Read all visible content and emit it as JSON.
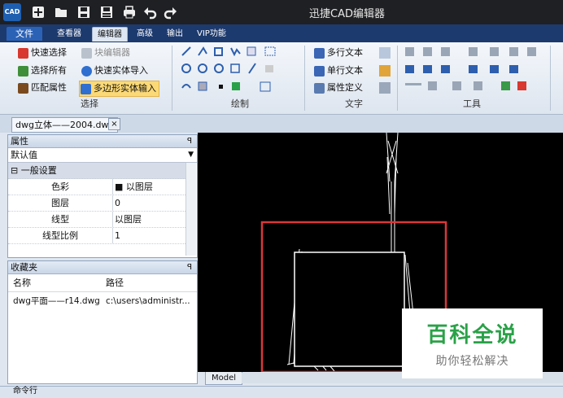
{
  "window": {
    "app_logo_text": "CAD",
    "title": "迅捷CAD编辑器"
  },
  "menu": {
    "tabs": [
      {
        "label": "文件"
      },
      {
        "label": "查看器"
      },
      {
        "label": "编辑器"
      },
      {
        "label": "高级"
      },
      {
        "label": "输出"
      },
      {
        "label": "VIP功能"
      }
    ]
  },
  "ribbon": {
    "select": {
      "quick_select": "快速选择",
      "block_editor": "块编辑器",
      "select_all": "选择所有",
      "quick_entity_import": "快速实体导入",
      "match_properties": "匹配属性",
      "polygon_entity_input": "多边形实体输入",
      "group_label": "选择"
    },
    "draw": {
      "group_label": "绘制"
    },
    "text": {
      "multiline_text": "多行文本",
      "single_line_text": "单行文本",
      "attribute_define": "属性定义",
      "group_label": "文字"
    },
    "tools": {
      "group_label": "工具"
    }
  },
  "document": {
    "tab_label": "dwg立体——2004.dwg",
    "close_glyph": "×"
  },
  "properties": {
    "title": "属性",
    "pin": "ꟼ",
    "selector_value": "默认值",
    "category": "⊟ 一般设置",
    "rows": [
      {
        "name": "色彩",
        "value": "■ 以图层"
      },
      {
        "name": "图层",
        "value": "0"
      },
      {
        "name": "线型",
        "value": "以图层"
      },
      {
        "name": "线型比例",
        "value": "1"
      }
    ]
  },
  "favorites": {
    "title": "收藏夹",
    "col_name": "名称",
    "col_path": "路径",
    "items": [
      {
        "name": "dwg平面——r14.dwg",
        "path": "c:\\users\\administr..."
      }
    ]
  },
  "canvas": {
    "model_tab": "Model"
  },
  "watermark": {
    "title": "百科全说",
    "subtitle": "助你轻松解决"
  },
  "command": {
    "label": "命令行"
  },
  "colors": {
    "titlebar": "#1f2023",
    "menubar": "#1d3a6e",
    "accent_file": "#2c62b6",
    "selection_box": "#d9373a",
    "watermark_green": "#2aa148"
  }
}
